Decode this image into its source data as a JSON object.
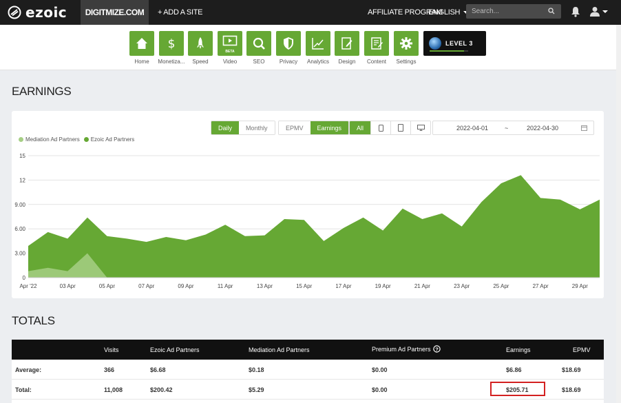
{
  "topbar": {
    "brand": "ezoic",
    "site": "DIGITMIZE.COM",
    "add_site": "+ ADD A SITE",
    "affiliate": "AFFILIATE PROGRAM",
    "language": "ENGLISH",
    "search_placeholder": "Search..."
  },
  "nav": {
    "items": [
      {
        "label": "Home",
        "icon": "home-icon"
      },
      {
        "label": "Monetiza...",
        "icon": "dollar-icon"
      },
      {
        "label": "Speed",
        "icon": "rocket-icon"
      },
      {
        "label": "Video",
        "icon": "video-icon",
        "badge": "BETA"
      },
      {
        "label": "SEO",
        "icon": "magnifier-icon"
      },
      {
        "label": "Privacy",
        "icon": "shield-icon"
      },
      {
        "label": "Analytics",
        "icon": "analytics-icon"
      },
      {
        "label": "Design",
        "icon": "design-icon"
      },
      {
        "label": "Content",
        "icon": "content-icon"
      },
      {
        "label": "Settings",
        "icon": "gear-icon"
      }
    ],
    "level_label": "LEVEL 3",
    "level_progress": 0.9
  },
  "earnings": {
    "title": "EARNINGS",
    "period_buttons": [
      "Daily",
      "Monthly"
    ],
    "metric_buttons": [
      "EPMV",
      "Earnings"
    ],
    "device_all": "All",
    "date_from": "2022-04-01",
    "date_separator": "~",
    "date_to": "2022-04-30"
  },
  "chart_data": {
    "type": "area",
    "x": [
      "Apr '22",
      "02 Apr",
      "03 Apr",
      "04 Apr",
      "05 Apr",
      "06 Apr",
      "07 Apr",
      "08 Apr",
      "09 Apr",
      "10 Apr",
      "11 Apr",
      "12 Apr",
      "13 Apr",
      "14 Apr",
      "15 Apr",
      "16 Apr",
      "17 Apr",
      "18 Apr",
      "19 Apr",
      "20 Apr",
      "21 Apr",
      "22 Apr",
      "23 Apr",
      "24 Apr",
      "25 Apr",
      "26 Apr",
      "27 Apr",
      "28 Apr",
      "29 Apr",
      "30 Apr"
    ],
    "x_tick_labels": [
      "Apr '22",
      "03 Apr",
      "05 Apr",
      "07 Apr",
      "09 Apr",
      "11 Apr",
      "13 Apr",
      "15 Apr",
      "17 Apr",
      "19 Apr",
      "21 Apr",
      "23 Apr",
      "25 Apr",
      "27 Apr",
      "29 Apr"
    ],
    "y_ticks": [
      "0",
      "3.00",
      "6.00",
      "9.00",
      "12",
      "15"
    ],
    "ylim": [
      0,
      15
    ],
    "grid": true,
    "legend_position": "top-left",
    "series": [
      {
        "name": "Mediation Ad Partners",
        "color": "#a6cf85",
        "values": [
          0.8,
          1.2,
          0.8,
          3.0,
          0,
          0,
          0,
          0,
          0,
          0,
          0,
          0,
          0,
          0,
          0,
          0,
          0,
          0,
          0,
          0,
          0,
          0,
          0,
          0,
          0,
          0,
          0,
          0,
          0,
          0
        ]
      },
      {
        "name": "Ezoic Ad Partners",
        "color": "#66a834",
        "values": [
          3.9,
          5.6,
          4.8,
          7.4,
          5.1,
          4.8,
          4.4,
          5.0,
          4.6,
          5.3,
          6.5,
          5.1,
          5.2,
          7.2,
          7.1,
          4.5,
          6.1,
          7.4,
          5.8,
          8.5,
          7.2,
          7.9,
          6.3,
          9.3,
          11.6,
          12.6,
          9.8,
          9.6,
          8.4,
          9.6
        ]
      }
    ]
  },
  "totals": {
    "title": "TOTALS",
    "columns": [
      "Visits",
      "Ezoic Ad Partners",
      "Mediation Ad Partners",
      "Premium Ad Partners",
      "Earnings",
      "EPMV"
    ],
    "rows": [
      {
        "label": "Average:",
        "values": [
          "366",
          "$6.68",
          "$0.18",
          "$0.00",
          "$6.86",
          "$18.69"
        ]
      },
      {
        "label": "Total:",
        "values": [
          "11,008",
          "$200.42",
          "$5.29",
          "$0.00",
          "$205.71",
          "$18.69"
        ]
      }
    ]
  }
}
